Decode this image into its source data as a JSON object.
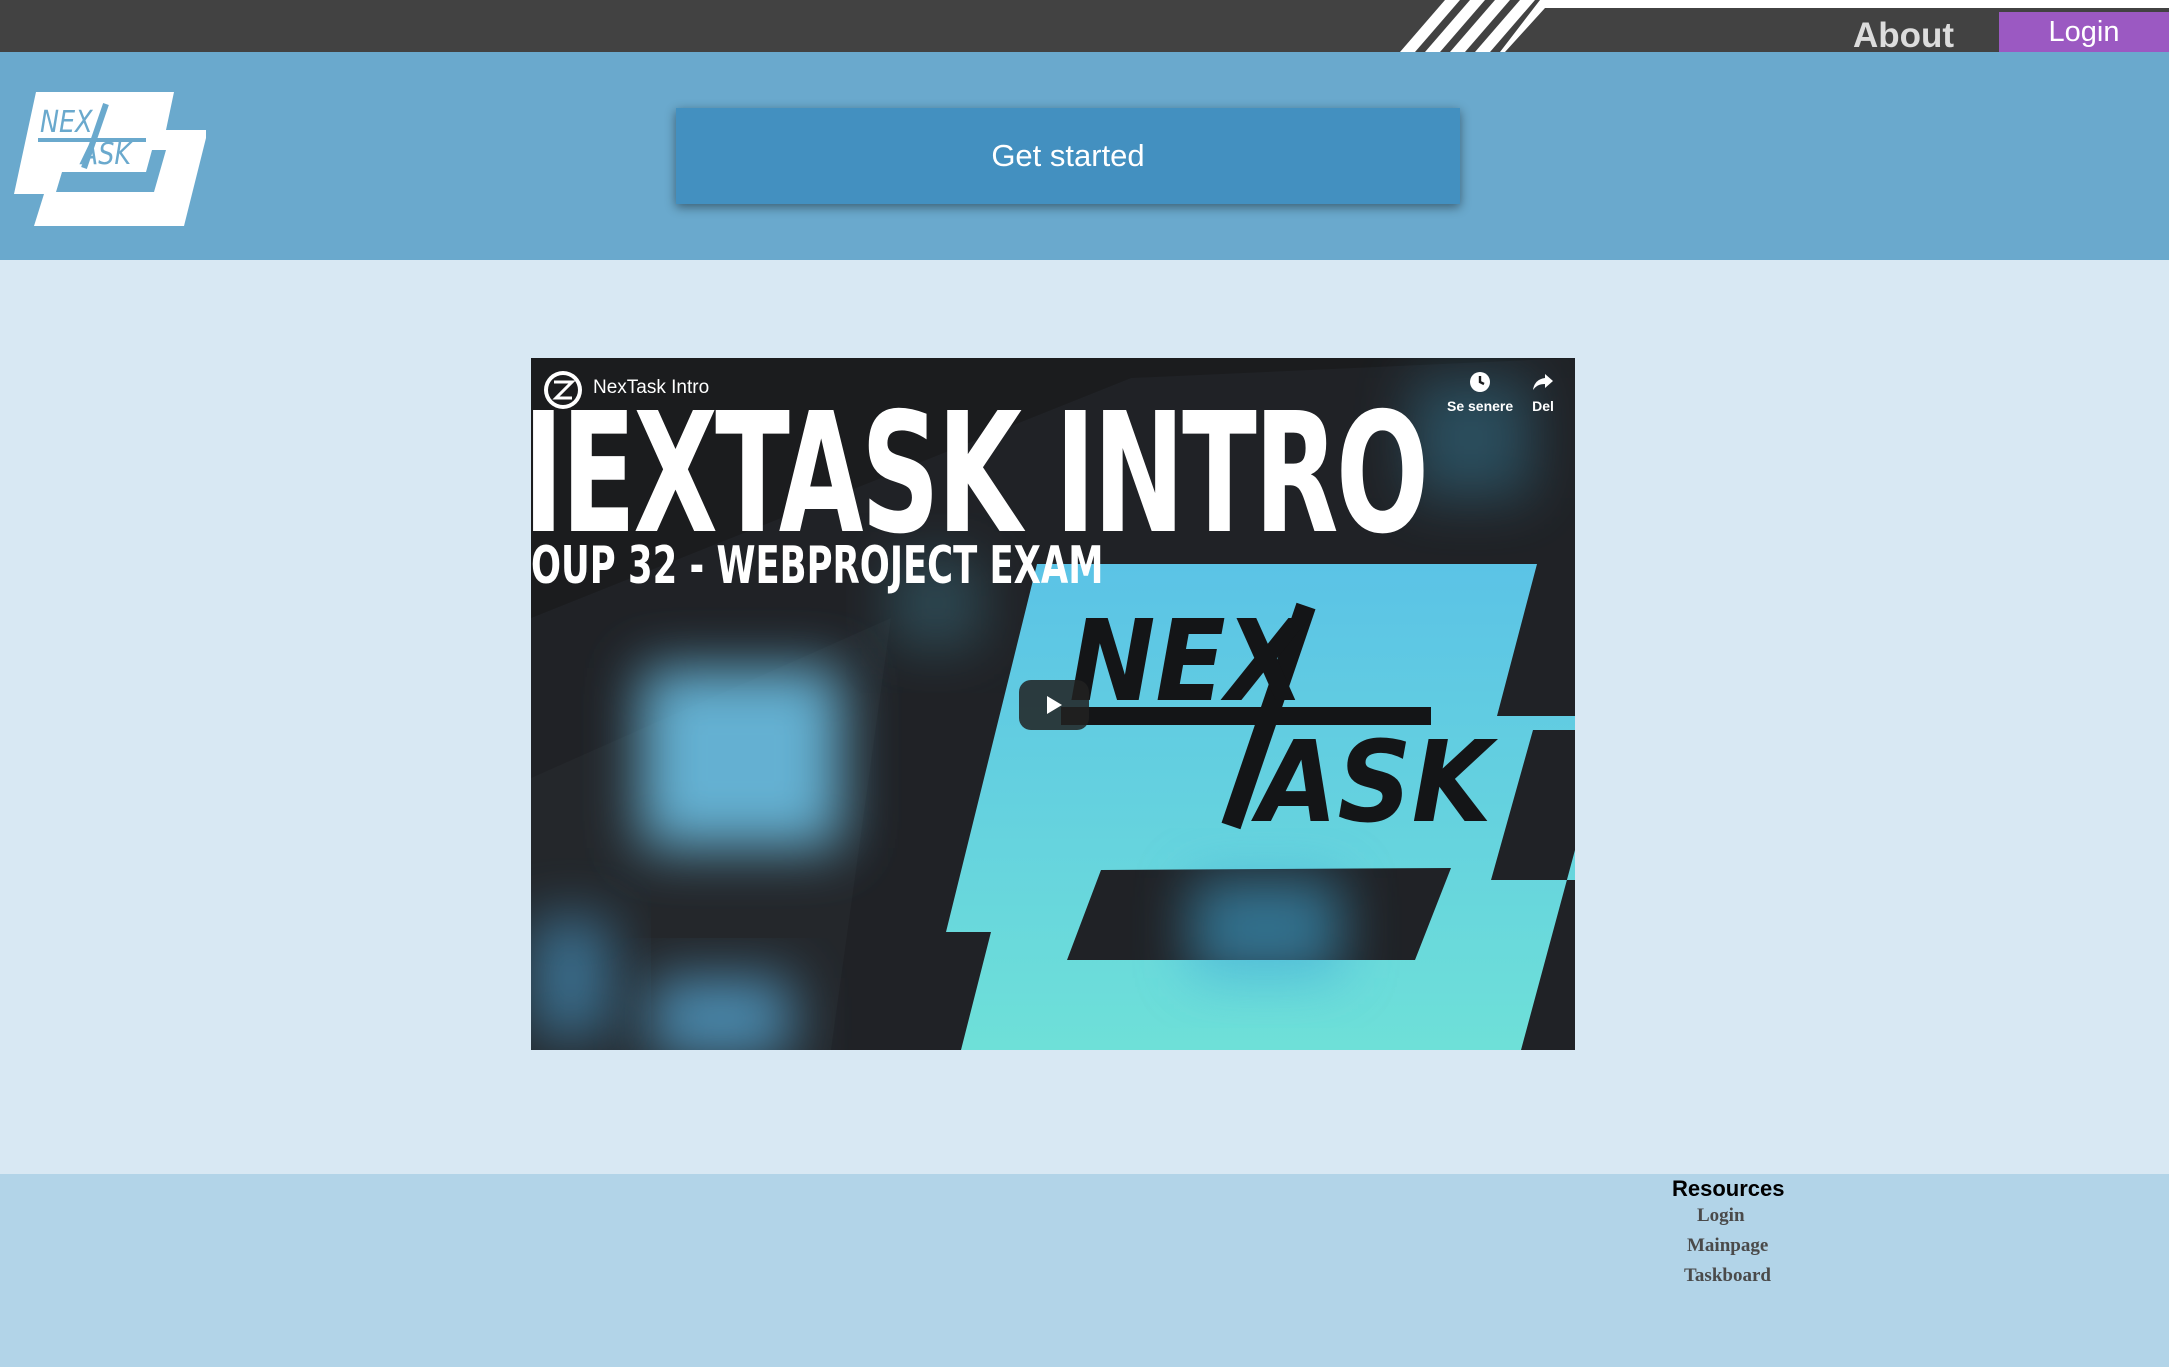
{
  "nav": {
    "about_label": "About",
    "login_label": "Login"
  },
  "header": {
    "logo_line1": "NEX",
    "logo_line2": "ASK",
    "cta_label": "Get started"
  },
  "video": {
    "channel_title": "NexTask Intro",
    "big_title": "IEXTASK INTRO",
    "subtitle": "OUP 32 - WEBPROJECT EXAM",
    "logo_line1": "NEX",
    "logo_line2": "ASK",
    "watch_later_label": "Se senere",
    "share_label": "Del"
  },
  "footer": {
    "resources_title": "Resources",
    "links": [
      "Login",
      "Mainpage",
      "Taskboard"
    ]
  },
  "colors": {
    "topbar": "#424242",
    "header": "#6aa9cd",
    "cta": "#4390c0",
    "login_button": "#9b59c2",
    "page_bg": "#d8e8f3",
    "footer_bg": "#b2d4e8",
    "video_logo": "#5fcfe0"
  }
}
